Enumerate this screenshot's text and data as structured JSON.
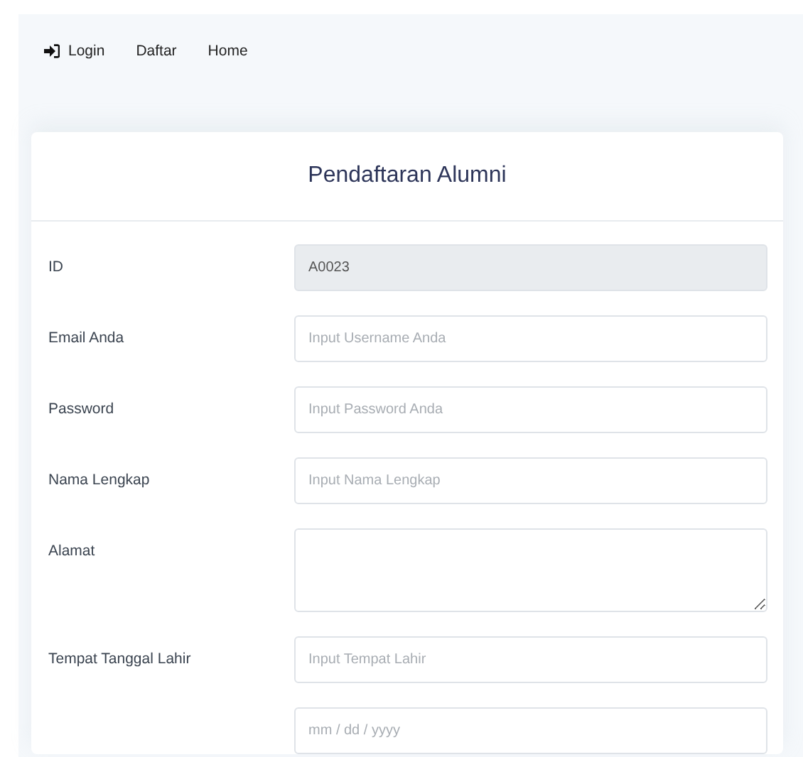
{
  "nav": [
    {
      "label": "Login",
      "icon": true
    },
    {
      "label": "Daftar",
      "icon": false
    },
    {
      "label": "Home",
      "icon": false
    }
  ],
  "form": {
    "title": "Pendaftaran Alumni",
    "fields": [
      {
        "kind": "text",
        "label": "ID",
        "value": "A0023",
        "disabled": true
      },
      {
        "kind": "text",
        "label": "Email Anda",
        "placeholder": "Input Username Anda",
        "disabled": false
      },
      {
        "kind": "text",
        "label": "Password",
        "placeholder": "Input Password Anda",
        "disabled": false
      },
      {
        "kind": "text",
        "label": "Nama Lengkap",
        "placeholder": "Input Nama Lengkap",
        "disabled": false
      },
      {
        "kind": "textarea",
        "label": "Alamat",
        "disabled": false
      },
      {
        "kind": "text",
        "label": "Tempat Tanggal Lahir",
        "placeholder": "Input Tempat Lahir",
        "disabled": false
      },
      {
        "kind": "text",
        "placeholder": "mm / dd / yyyy",
        "disabled": false
      }
    ]
  }
}
